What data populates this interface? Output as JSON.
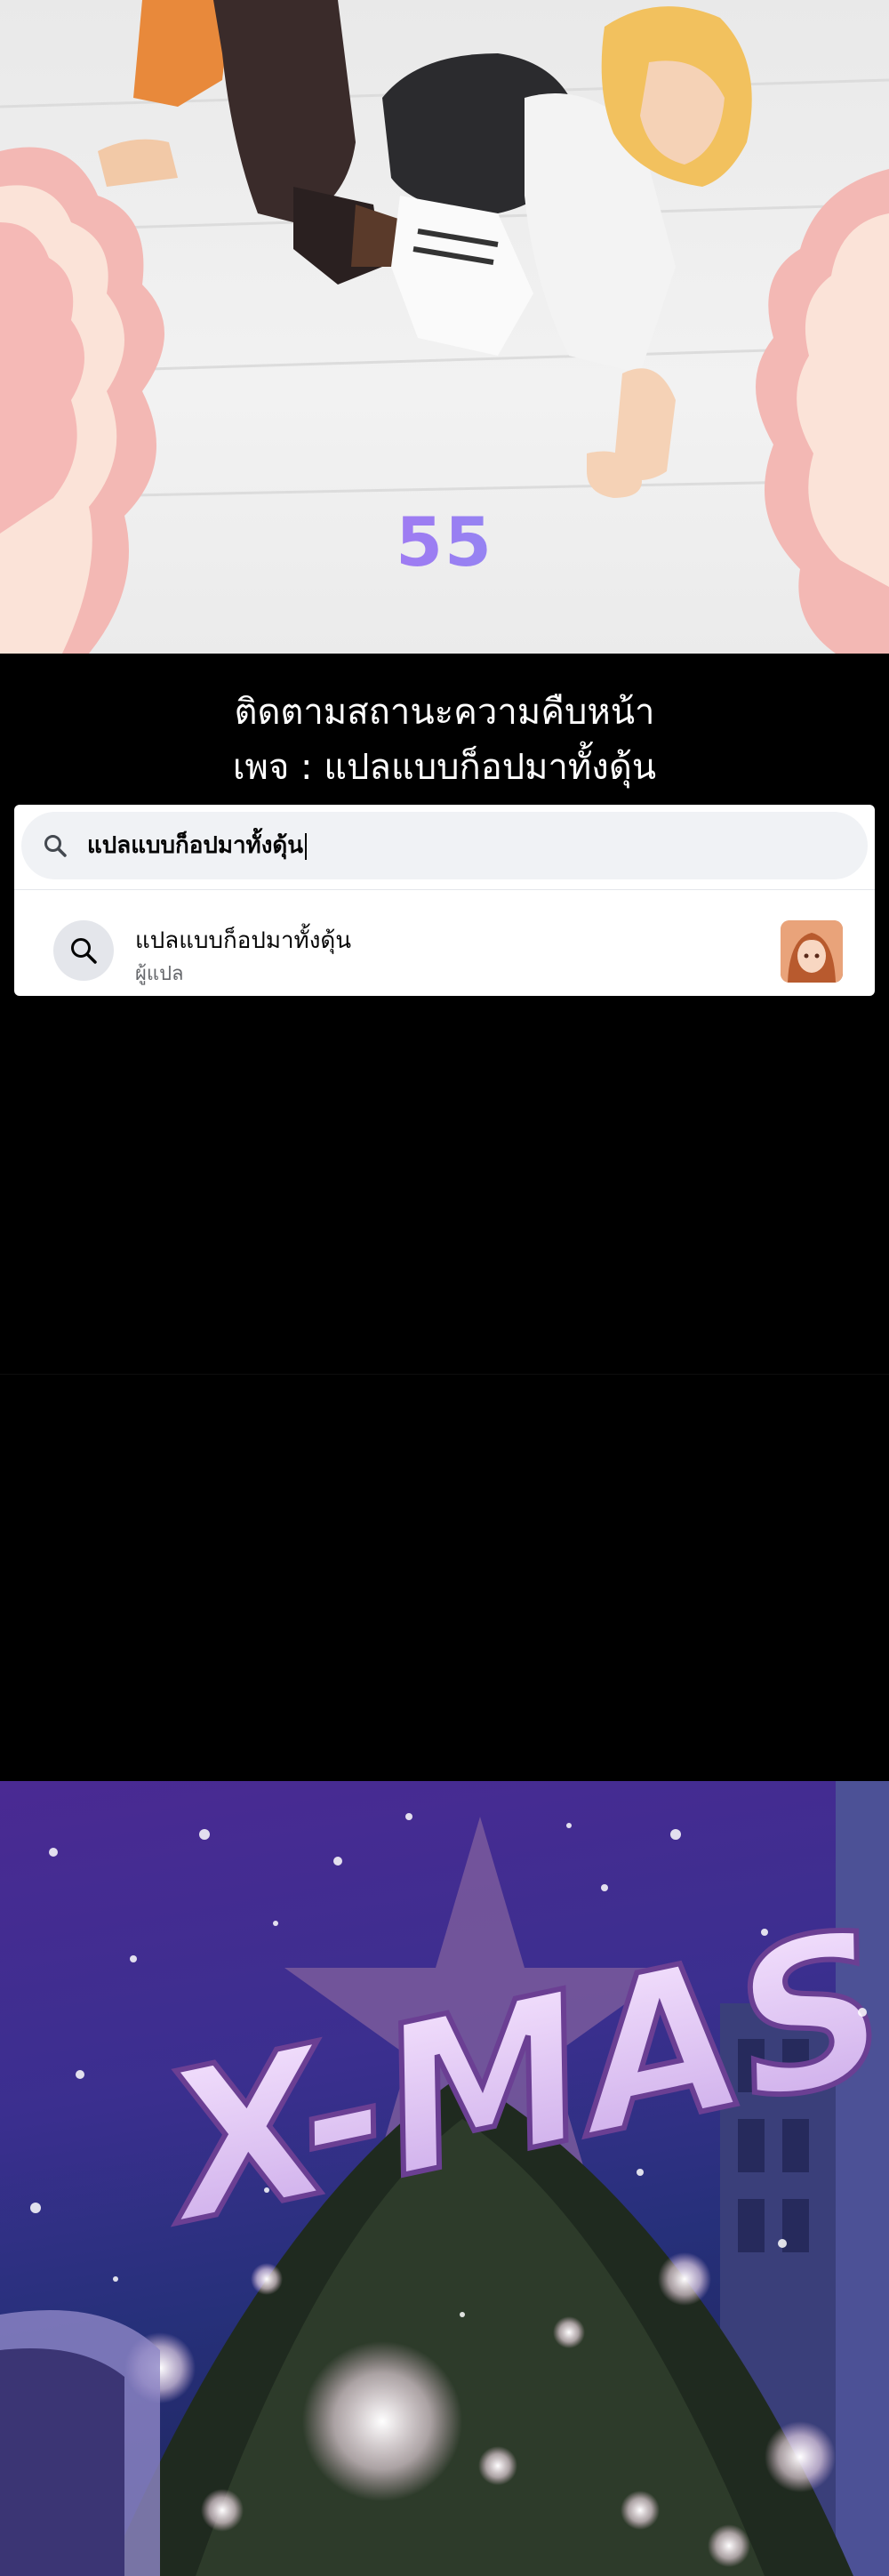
{
  "comic": {
    "page_number": "55"
  },
  "notice": {
    "line1": "ติดตามสถานะความคืบหน้า",
    "line2": "เพจ : แปลแบบก็อปมาทั้งดุ้น"
  },
  "search": {
    "query": "แปลแบบก็อปมาทั้งดุ้น",
    "icon": "search-icon"
  },
  "result": {
    "title": "แปลแบบก็อปมาทั้งดุ้น",
    "subtitle": "ผู้แปล",
    "icon": "search-icon",
    "avatar_icon": "page-avatar"
  },
  "banner": {
    "text": "X-MAS"
  },
  "colors": {
    "background": "#000000",
    "search_bg": "#f0f2f5",
    "subtitle": "#65676b",
    "page_number_start": "#c86af0",
    "page_number_end": "#6fb6f5"
  }
}
